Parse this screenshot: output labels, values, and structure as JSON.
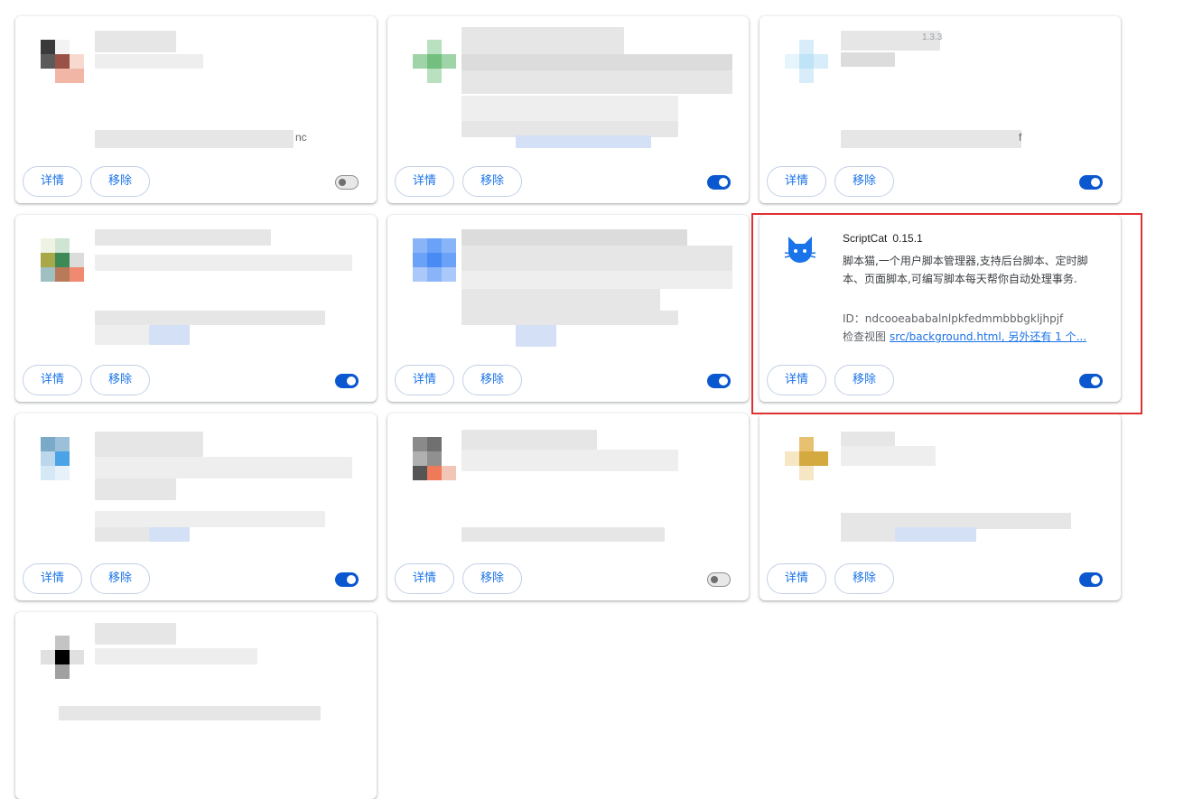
{
  "card_buttons": {
    "details_label": "详情",
    "remove_label": "移除"
  },
  "cards": [
    {
      "enabled": false
    },
    {
      "enabled": true
    },
    {
      "enabled": true
    },
    {
      "enabled": true
    },
    {
      "enabled": true
    },
    {
      "enabled": true
    },
    {
      "enabled": true
    },
    {
      "enabled": false
    },
    {
      "enabled": true
    },
    {
      "enabled": true
    }
  ],
  "scriptcat": {
    "name": "ScriptCat",
    "version": "0.15.1",
    "description": "脚本猫,一个用户脚本管理器,支持后台脚本、定时脚本、页面脚本,可编写脚本每天帮你自动处理事务.",
    "id_label": "ID：ndcooeababalnlpkfedmmbbbgkljhpjf",
    "inspect_label": "检查视图",
    "inspect_link": "src/background.html, 另外还有 1 个...",
    "icon": "cat-icon",
    "accent_color": "#1a73e8",
    "highlight_color": "#e03131"
  },
  "partial_texts": {
    "card1_tail": "nc",
    "card3_version_tail": "1.3.3",
    "card3_tail": "f"
  }
}
